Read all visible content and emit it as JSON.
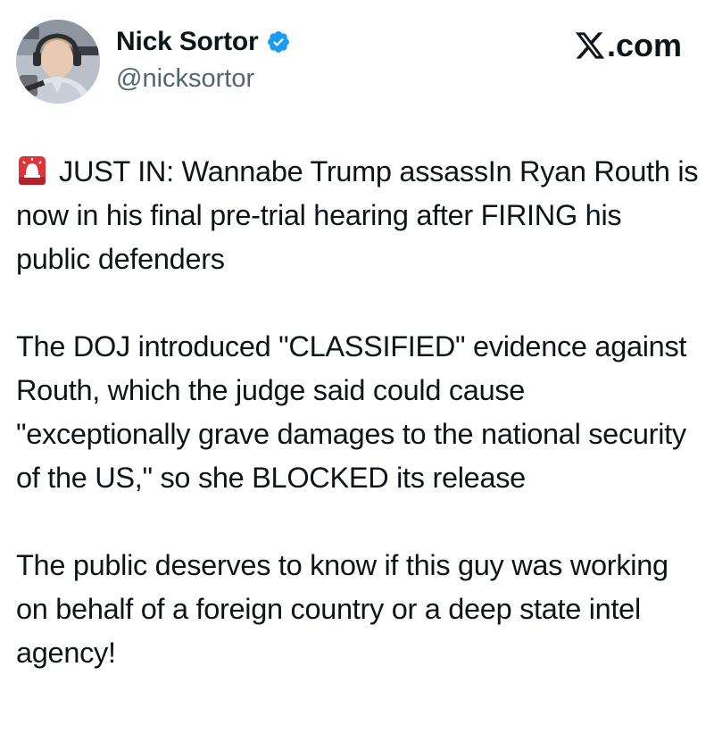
{
  "author": {
    "display_name": "Nick Sortor",
    "handle": "@nicksortor",
    "verified": true,
    "avatar_icon": "profile-photo"
  },
  "brand": {
    "site": ".com",
    "logo_icon": "x-logo-icon"
  },
  "tweet": {
    "lead_icon": "police-siren-emoji",
    "paragraphs": [
      "JUST IN: Wannabe Trump assassIn Ryan Routh is now in his final pre-trial hearing after FIRING his public defenders",
      "The DOJ introduced \"CLASSIFIED\" evidence against Routh, which the judge said could cause \"exceptionally grave damages to the national security of the US,\" so she BLOCKED its release",
      "The public deserves to know if this guy was working on behalf of a foreign country or a deep state intel agency!"
    ]
  },
  "colors": {
    "text": "#0f1419",
    "secondary_text": "#536471",
    "verified_badge": "#1d9bf0",
    "siren_red": "#e0333a"
  }
}
